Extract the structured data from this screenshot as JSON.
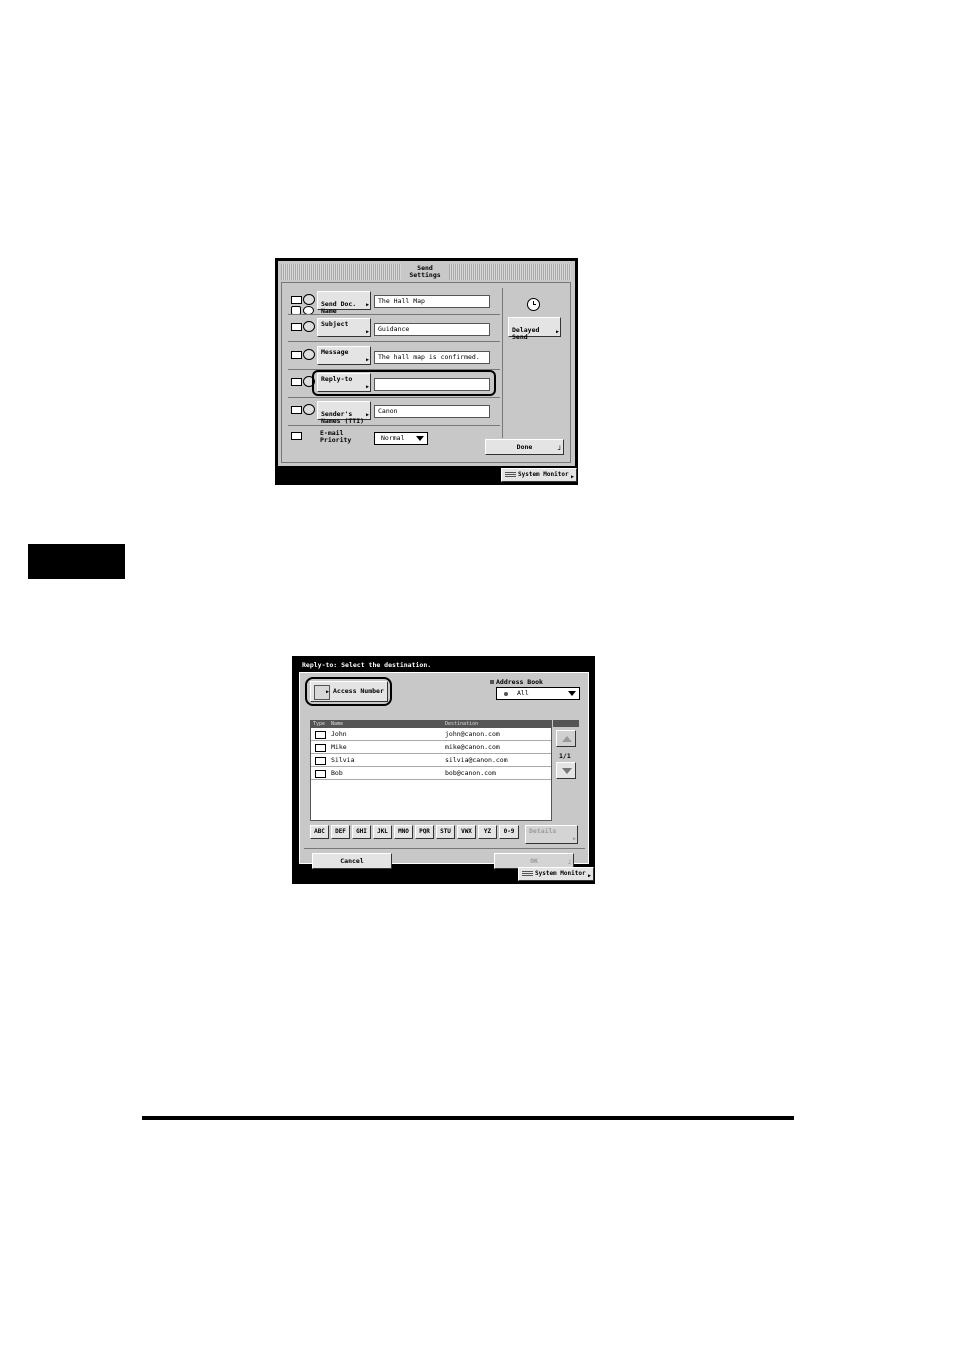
{
  "send_settings": {
    "title": "Send\nSettings",
    "rows": [
      {
        "label": "Send Doc.\nName",
        "value": "The Hall Map"
      },
      {
        "label": "Subject",
        "value": "Guidance"
      },
      {
        "label": "Message",
        "value": "The hall map is confirmed."
      },
      {
        "label": "Reply-to",
        "value": ""
      },
      {
        "label": "Sender's\nNames (TTI)",
        "value": "Canon"
      }
    ],
    "priority_label": "E-mail\nPriority",
    "priority_value": "Normal",
    "delayed_send_label": "Delayed\nSend",
    "done_label": "Done",
    "system_monitor_label": "System Monitor"
  },
  "reply_to": {
    "header": "Reply-to: Select the destination.",
    "access_number_label": "Access Number",
    "address_book_label": "Address Book",
    "address_book_value": "All",
    "columns": {
      "type": "Type",
      "name": "Name",
      "destination": "Destination"
    },
    "entries": [
      {
        "name": "John",
        "email": "john@canon.com"
      },
      {
        "name": "Mike",
        "email": "mike@canon.com"
      },
      {
        "name": "Silvia",
        "email": "silvia@canon.com"
      },
      {
        "name": "Bob",
        "email": "bob@canon.com"
      }
    ],
    "page": "1/1",
    "alpha_keys": [
      "ABC",
      "DEF",
      "GHI",
      "JKL",
      "MNO",
      "PQR",
      "STU",
      "VWX",
      "YZ",
      "0-9"
    ],
    "details_label": "Details",
    "cancel_label": "Cancel",
    "ok_label": "OK",
    "system_monitor_label": "System Monitor"
  }
}
